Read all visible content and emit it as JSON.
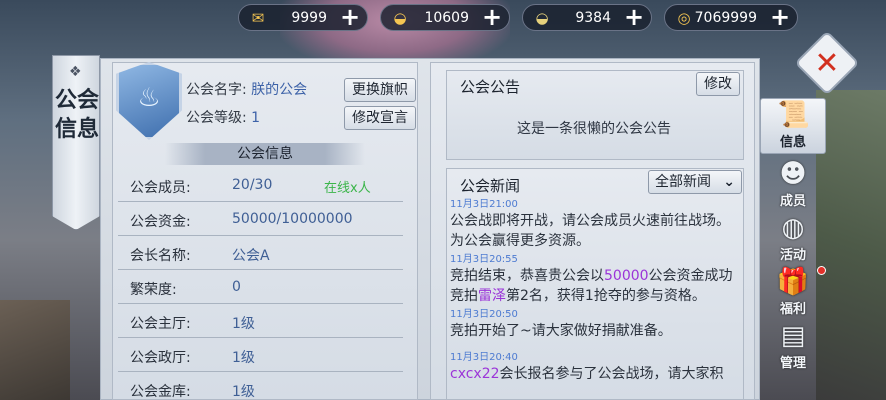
{
  "resources": [
    {
      "icon": "red-envelope-icon",
      "value": "9999"
    },
    {
      "icon": "gold-ingot-icon",
      "value": "10609"
    },
    {
      "icon": "silver-ingot-icon",
      "value": "9384"
    },
    {
      "icon": "copper-coin-icon",
      "value": "7069999"
    }
  ],
  "ribbon": {
    "title": "公会信息"
  },
  "guild": {
    "name_label": "公会名字:",
    "name": "朕的公会",
    "level_label": "公会等级:",
    "level": "1",
    "change_banner": "更换旗帜",
    "edit_motto": "修改宣言",
    "info_title": "公会信息"
  },
  "info_rows": [
    {
      "key": "公会成员:",
      "value": "20/30",
      "extra": "在线x人"
    },
    {
      "key": "公会资金:",
      "value": "50000/10000000",
      "extra": ""
    },
    {
      "key": "会长名称:",
      "value": "公会A",
      "extra": ""
    },
    {
      "key": "繁荣度:",
      "value": "0",
      "extra": ""
    },
    {
      "key": "公会主厅:",
      "value": "1级",
      "extra": ""
    },
    {
      "key": "公会政厅:",
      "value": "1级",
      "extra": ""
    },
    {
      "key": "公会金库:",
      "value": "1级",
      "extra": ""
    }
  ],
  "notice": {
    "title": "公会公告",
    "edit": "修改",
    "text": "这是一条很懒的公会公告"
  },
  "news": {
    "title": "公会新闻",
    "filter": "全部新闻",
    "items": [
      {
        "time": "11月3日21:00",
        "parts": [
          "公会战即将开战，请公会成员火速前往战场。为公会赢得更多资源。"
        ]
      },
      {
        "time": "11月3日20:55",
        "parts": [
          "竞拍结束，恭喜贵公会以",
          "50000",
          "公会资金成功竞拍",
          "雷泽",
          "第2名，获得1抢夺的参与资格。"
        ]
      },
      {
        "time": "11月3日20:50",
        "parts": [
          "竞拍开始了~请大家做好捐献准备。"
        ]
      },
      {
        "time": "11月3日20:40",
        "parts": [
          "cxcx22",
          "会长报名参与了公会战场，请大家积"
        ]
      }
    ]
  },
  "tabs": [
    {
      "icon": "scroll-icon",
      "label": "信息",
      "active": true
    },
    {
      "icon": "members-icon",
      "label": "成员",
      "active": false
    },
    {
      "icon": "activity-icon",
      "label": "活动",
      "active": false
    },
    {
      "icon": "gift-icon",
      "label": "福利",
      "active": false
    },
    {
      "icon": "manage-icon",
      "label": "管理",
      "active": false
    }
  ],
  "colors": {
    "accent_blue": "#3f5f95",
    "online_green": "#3bb54a",
    "highlight_purple": "#9b35d8",
    "alert_red": "#e2312a"
  }
}
